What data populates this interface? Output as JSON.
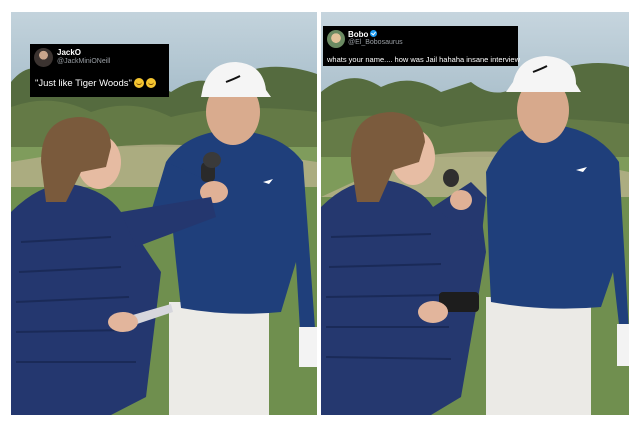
{
  "left_post": {
    "display_name": "JackO",
    "handle": "@JackMiniONeill",
    "text": "\"Just like Tiger Woods\"",
    "emojis": [
      "crying-face-icon",
      "rolling-laughing-face-icon"
    ]
  },
  "right_post": {
    "display_name": "Bobo",
    "verified": true,
    "handle": "@El_Bobosaurus",
    "text": "whats your name.... how was Jail hahaha insane interview"
  },
  "colors": {
    "sweater": "#1e3f7a",
    "jacket": "#24366f",
    "grass": "#7e9a5a",
    "sky": "#a9c0cc",
    "caption_bg": "#000000"
  }
}
